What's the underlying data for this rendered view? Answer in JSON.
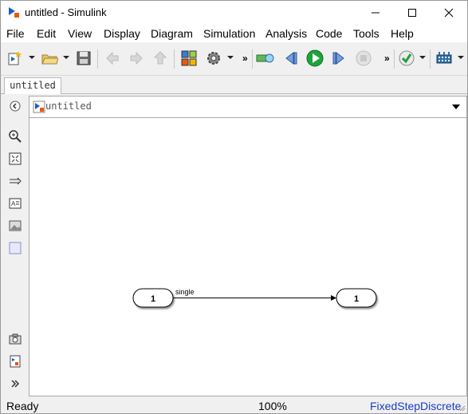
{
  "window": {
    "title": "untitled - Simulink",
    "controls": {
      "minimize": "minimize",
      "maximize": "maximize",
      "close": "close"
    }
  },
  "menubar": {
    "items": [
      "File",
      "Edit",
      "View",
      "Display",
      "Diagram",
      "Simulation",
      "Analysis",
      "Code",
      "Tools",
      "Help"
    ]
  },
  "toolbar": {
    "icons": [
      "new-model-icon",
      "open-folder-icon",
      "save-icon",
      "back-icon",
      "forward-icon",
      "up-icon",
      "library-browser-icon",
      "model-config-icon",
      "step-back-icon",
      "run-icon",
      "step-forward-icon",
      "stop-icon",
      "model-advisor-icon",
      "build-icon"
    ],
    "more_label": "»"
  },
  "tabs": [
    {
      "label": "untitled"
    }
  ],
  "address": {
    "path": "untitled"
  },
  "left_tools": [
    "back-icon",
    "zoom-in-icon",
    "fit-to-view-icon",
    "signal-arrow-icon",
    "annotation-icon",
    "image-icon",
    "area-icon",
    "camera-icon",
    "model-info-icon",
    "expand-icon"
  ],
  "diagram": {
    "blocks": [
      {
        "name": "inport",
        "label": "1"
      },
      {
        "name": "outport",
        "label": "1"
      }
    ],
    "signal": {
      "label": "single"
    }
  },
  "status": {
    "state": "Ready",
    "zoom": "100%",
    "solver": "FixedStepDiscrete"
  },
  "colors": {
    "run_green": "#1fa33a",
    "solver_blue": "#1a3cc7"
  }
}
